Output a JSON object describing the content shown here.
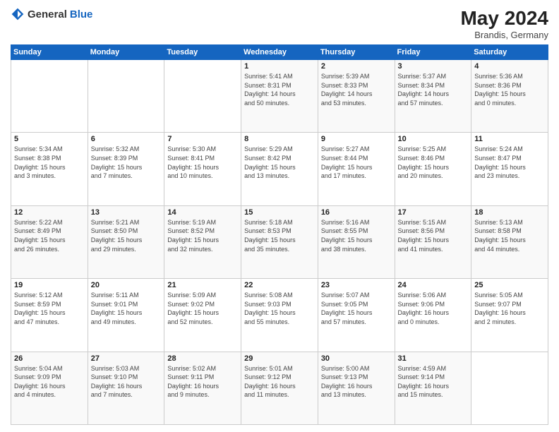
{
  "header": {
    "logo_general": "General",
    "logo_blue": "Blue",
    "month": "May 2024",
    "location": "Brandis, Germany"
  },
  "weekdays": [
    "Sunday",
    "Monday",
    "Tuesday",
    "Wednesday",
    "Thursday",
    "Friday",
    "Saturday"
  ],
  "weeks": [
    [
      {
        "day": "",
        "info": ""
      },
      {
        "day": "",
        "info": ""
      },
      {
        "day": "",
        "info": ""
      },
      {
        "day": "1",
        "info": "Sunrise: 5:41 AM\nSunset: 8:31 PM\nDaylight: 14 hours\nand 50 minutes."
      },
      {
        "day": "2",
        "info": "Sunrise: 5:39 AM\nSunset: 8:33 PM\nDaylight: 14 hours\nand 53 minutes."
      },
      {
        "day": "3",
        "info": "Sunrise: 5:37 AM\nSunset: 8:34 PM\nDaylight: 14 hours\nand 57 minutes."
      },
      {
        "day": "4",
        "info": "Sunrise: 5:36 AM\nSunset: 8:36 PM\nDaylight: 15 hours\nand 0 minutes."
      }
    ],
    [
      {
        "day": "5",
        "info": "Sunrise: 5:34 AM\nSunset: 8:38 PM\nDaylight: 15 hours\nand 3 minutes."
      },
      {
        "day": "6",
        "info": "Sunrise: 5:32 AM\nSunset: 8:39 PM\nDaylight: 15 hours\nand 7 minutes."
      },
      {
        "day": "7",
        "info": "Sunrise: 5:30 AM\nSunset: 8:41 PM\nDaylight: 15 hours\nand 10 minutes."
      },
      {
        "day": "8",
        "info": "Sunrise: 5:29 AM\nSunset: 8:42 PM\nDaylight: 15 hours\nand 13 minutes."
      },
      {
        "day": "9",
        "info": "Sunrise: 5:27 AM\nSunset: 8:44 PM\nDaylight: 15 hours\nand 17 minutes."
      },
      {
        "day": "10",
        "info": "Sunrise: 5:25 AM\nSunset: 8:46 PM\nDaylight: 15 hours\nand 20 minutes."
      },
      {
        "day": "11",
        "info": "Sunrise: 5:24 AM\nSunset: 8:47 PM\nDaylight: 15 hours\nand 23 minutes."
      }
    ],
    [
      {
        "day": "12",
        "info": "Sunrise: 5:22 AM\nSunset: 8:49 PM\nDaylight: 15 hours\nand 26 minutes."
      },
      {
        "day": "13",
        "info": "Sunrise: 5:21 AM\nSunset: 8:50 PM\nDaylight: 15 hours\nand 29 minutes."
      },
      {
        "day": "14",
        "info": "Sunrise: 5:19 AM\nSunset: 8:52 PM\nDaylight: 15 hours\nand 32 minutes."
      },
      {
        "day": "15",
        "info": "Sunrise: 5:18 AM\nSunset: 8:53 PM\nDaylight: 15 hours\nand 35 minutes."
      },
      {
        "day": "16",
        "info": "Sunrise: 5:16 AM\nSunset: 8:55 PM\nDaylight: 15 hours\nand 38 minutes."
      },
      {
        "day": "17",
        "info": "Sunrise: 5:15 AM\nSunset: 8:56 PM\nDaylight: 15 hours\nand 41 minutes."
      },
      {
        "day": "18",
        "info": "Sunrise: 5:13 AM\nSunset: 8:58 PM\nDaylight: 15 hours\nand 44 minutes."
      }
    ],
    [
      {
        "day": "19",
        "info": "Sunrise: 5:12 AM\nSunset: 8:59 PM\nDaylight: 15 hours\nand 47 minutes."
      },
      {
        "day": "20",
        "info": "Sunrise: 5:11 AM\nSunset: 9:01 PM\nDaylight: 15 hours\nand 49 minutes."
      },
      {
        "day": "21",
        "info": "Sunrise: 5:09 AM\nSunset: 9:02 PM\nDaylight: 15 hours\nand 52 minutes."
      },
      {
        "day": "22",
        "info": "Sunrise: 5:08 AM\nSunset: 9:03 PM\nDaylight: 15 hours\nand 55 minutes."
      },
      {
        "day": "23",
        "info": "Sunrise: 5:07 AM\nSunset: 9:05 PM\nDaylight: 15 hours\nand 57 minutes."
      },
      {
        "day": "24",
        "info": "Sunrise: 5:06 AM\nSunset: 9:06 PM\nDaylight: 16 hours\nand 0 minutes."
      },
      {
        "day": "25",
        "info": "Sunrise: 5:05 AM\nSunset: 9:07 PM\nDaylight: 16 hours\nand 2 minutes."
      }
    ],
    [
      {
        "day": "26",
        "info": "Sunrise: 5:04 AM\nSunset: 9:09 PM\nDaylight: 16 hours\nand 4 minutes."
      },
      {
        "day": "27",
        "info": "Sunrise: 5:03 AM\nSunset: 9:10 PM\nDaylight: 16 hours\nand 7 minutes."
      },
      {
        "day": "28",
        "info": "Sunrise: 5:02 AM\nSunset: 9:11 PM\nDaylight: 16 hours\nand 9 minutes."
      },
      {
        "day": "29",
        "info": "Sunrise: 5:01 AM\nSunset: 9:12 PM\nDaylight: 16 hours\nand 11 minutes."
      },
      {
        "day": "30",
        "info": "Sunrise: 5:00 AM\nSunset: 9:13 PM\nDaylight: 16 hours\nand 13 minutes."
      },
      {
        "day": "31",
        "info": "Sunrise: 4:59 AM\nSunset: 9:14 PM\nDaylight: 16 hours\nand 15 minutes."
      },
      {
        "day": "",
        "info": ""
      }
    ]
  ]
}
